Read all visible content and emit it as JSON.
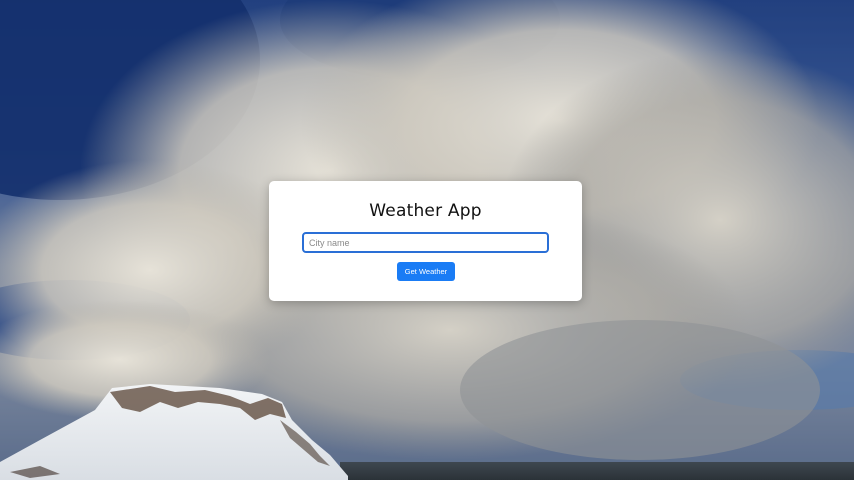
{
  "app": {
    "title": "Weather App"
  },
  "search": {
    "placeholder": "City name",
    "value": "",
    "button_label": "Get Weather"
  },
  "colors": {
    "accent": "#1a7cf5",
    "input_border": "#2a6fd6",
    "card_background": "#ffffff"
  }
}
